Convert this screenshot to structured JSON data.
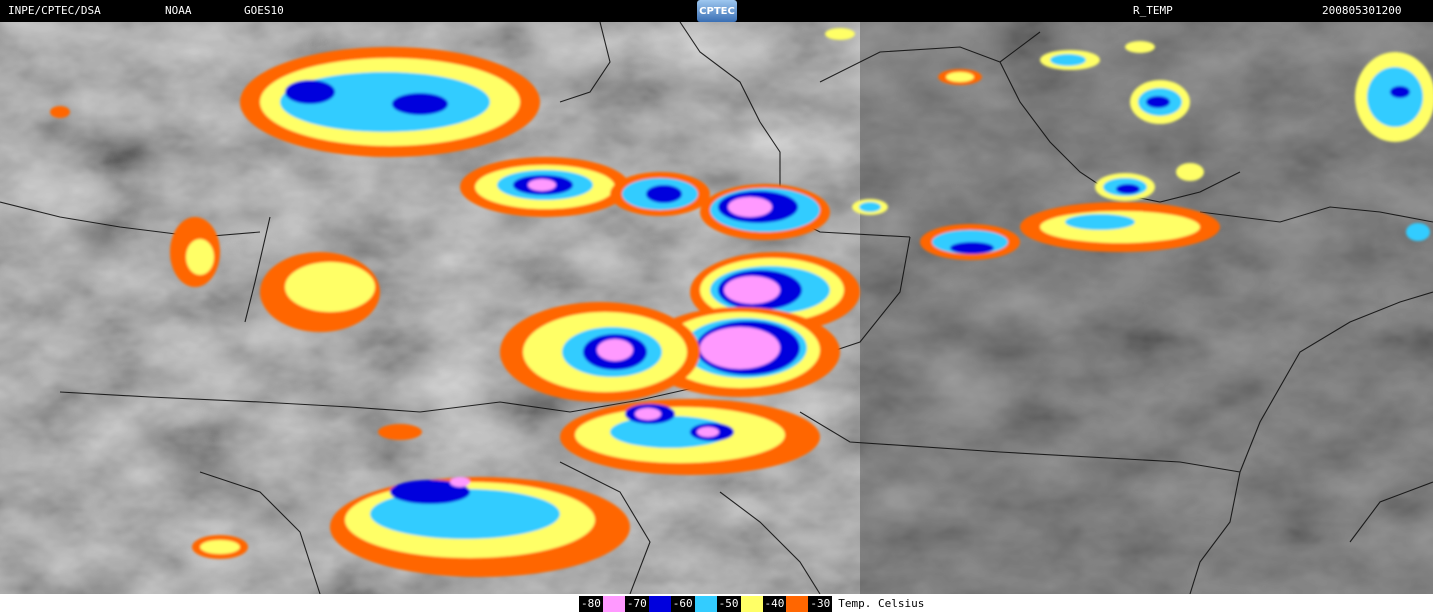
{
  "header": {
    "source": "INPE/CPTEC/DSA",
    "agency": "NOAA",
    "satellite": "GOES10",
    "logo": "CPTEC",
    "product": "R_TEMP",
    "datetime": "200805301200"
  },
  "legend": {
    "items": [
      {
        "label": "-80",
        "color": "#ff99ff"
      },
      {
        "label": "-70",
        "color": "#0000dd"
      },
      {
        "label": "-60",
        "color": "#33ccff"
      },
      {
        "label": "-50",
        "color": "#ffff66"
      },
      {
        "label": "-40",
        "color": "#ff6600"
      },
      {
        "label": "-30"
      }
    ],
    "title": "Temp. Celsius"
  },
  "map": {
    "background_color": "#6e6e6e",
    "border_color": "#111111"
  }
}
